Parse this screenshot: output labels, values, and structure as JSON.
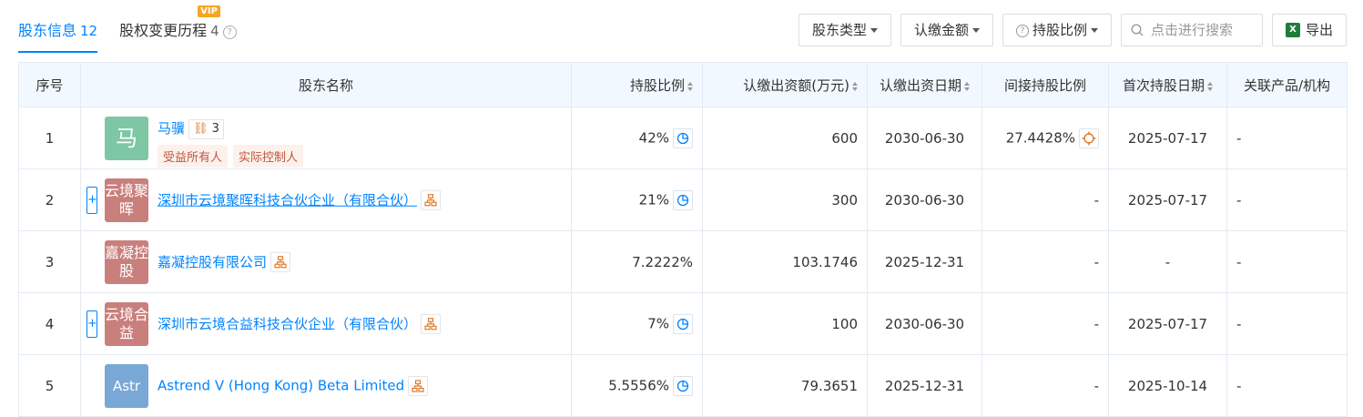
{
  "tabs": [
    {
      "label": "股东信息",
      "count": "12"
    },
    {
      "label": "股权变更历程",
      "count": "4",
      "badge": "VIP"
    }
  ],
  "filters": {
    "holder_type": "股东类型",
    "subscribed_amount": "认缴金额",
    "share_ratio": "持股比例",
    "search_placeholder": "点击进行搜索",
    "export": "导出"
  },
  "columns": [
    "序号",
    "股东名称",
    "持股比例",
    "认缴出资额(万元)",
    "认缴出资日期",
    "间接持股比例",
    "首次持股日期",
    "关联产品/机构"
  ],
  "rows": [
    {
      "no": "1",
      "logo": "马",
      "logo_color": "#7dc7a4",
      "name": "马骥",
      "control_count": "3",
      "tags": [
        "受益所有人",
        "实际控制人"
      ],
      "ratio": "42%",
      "amount": "600",
      "date": "2030-06-30",
      "indirect": "27.4428%",
      "first_date": "2025-07-17",
      "related": "-"
    },
    {
      "no": "2",
      "logo": "云境聚晖",
      "logo_color": "#c97f7c",
      "name": "深圳市云境聚晖科技合伙企业（有限合伙）",
      "expandable": true,
      "ratio": "21%",
      "amount": "300",
      "date": "2030-06-30",
      "indirect": "-",
      "first_date": "2025-07-17",
      "related": "-"
    },
    {
      "no": "3",
      "logo": "嘉凝控股",
      "logo_color": "#c97f7c",
      "name": "嘉凝控股有限公司",
      "ratio": "7.2222%",
      "amount": "103.1746",
      "date": "2025-12-31",
      "indirect": "-",
      "first_date": "-",
      "related": "-"
    },
    {
      "no": "4",
      "logo": "云境合益",
      "logo_color": "#c97f7c",
      "name": "深圳市云境合益科技合伙企业（有限合伙）",
      "expandable": true,
      "ratio": "7%",
      "amount": "100",
      "date": "2030-06-30",
      "indirect": "-",
      "first_date": "2025-07-17",
      "related": "-"
    },
    {
      "no": "5",
      "logo": "Astr",
      "logo_color": "#7aa8d6",
      "name": "Astrend V (Hong Kong) Beta Limited",
      "ratio": "5.5556%",
      "amount": "79.3651",
      "date": "2025-12-31",
      "indirect": "-",
      "first_date": "2025-10-14",
      "related": "-"
    }
  ],
  "colors": {
    "accent": "#0084ff",
    "header_bg": "#f2f8ff",
    "tag_bg": "#fdf1ec",
    "tag_text": "#c0553e",
    "struct_icon": "#e07b27"
  }
}
